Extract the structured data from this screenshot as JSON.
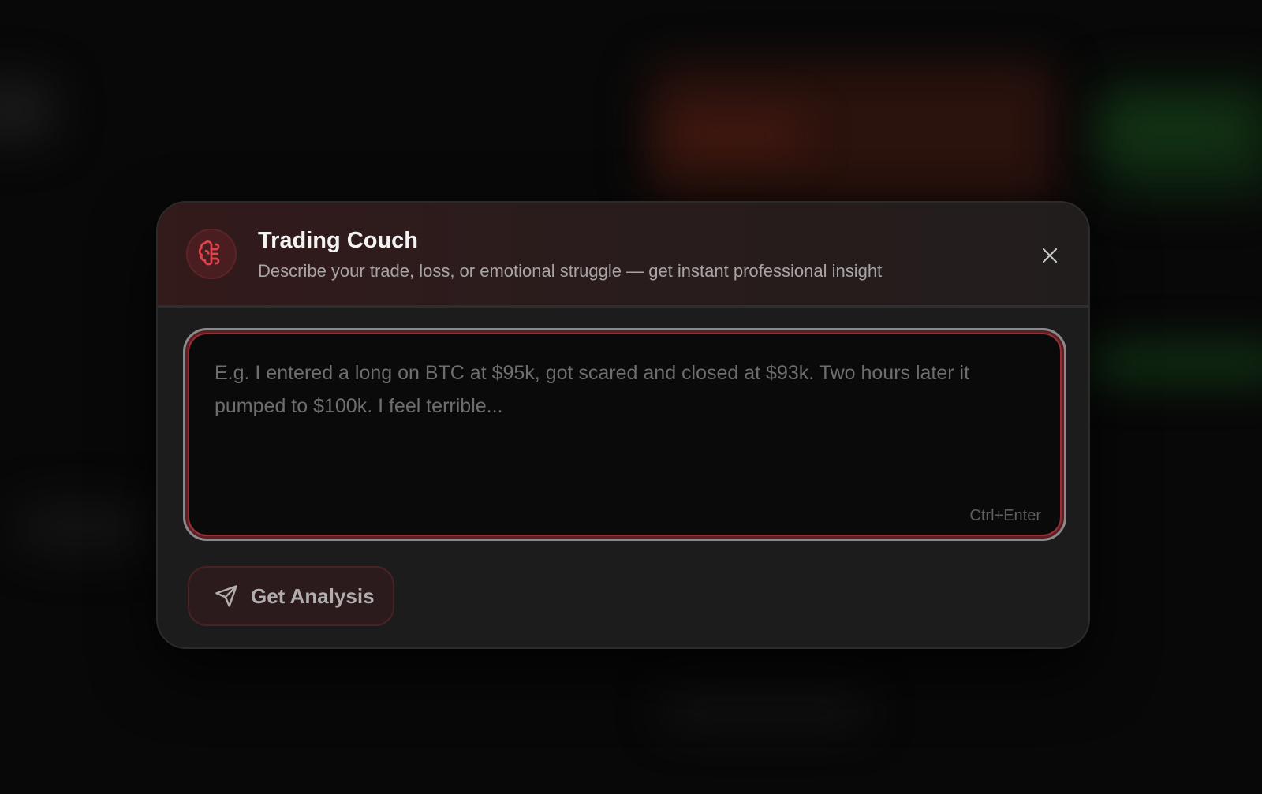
{
  "modal": {
    "title": "Trading Couch",
    "subtitle": "Describe your trade, loss, or emotional struggle — get instant professional insight",
    "icon": "brain-icon",
    "close_icon": "close-icon"
  },
  "input": {
    "value": "",
    "placeholder": "E.g. I entered a long on BTC at $95k, got scared and closed at $93k. Two hours later it pumped to $100k. I feel terrible...",
    "shortcut_hint": "Ctrl+Enter"
  },
  "actions": {
    "submit_label": "Get Analysis",
    "submit_icon": "send-icon"
  },
  "colors": {
    "accent": "#e0454f",
    "modal_bg": "#1c1c1c",
    "header_bg": "#331a1b"
  }
}
